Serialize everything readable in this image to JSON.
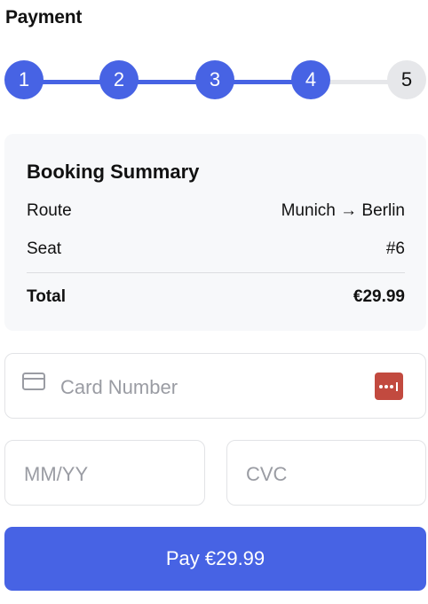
{
  "page": {
    "title": "Payment"
  },
  "stepper": {
    "current_step": 4,
    "steps": [
      {
        "label": "1",
        "state": "complete"
      },
      {
        "label": "2",
        "state": "complete"
      },
      {
        "label": "3",
        "state": "complete"
      },
      {
        "label": "4",
        "state": "current"
      },
      {
        "label": "5",
        "state": "upcoming"
      }
    ]
  },
  "summary": {
    "title": "Booking Summary",
    "rows": [
      {
        "label": "Route",
        "value": "Munich → Berlin"
      },
      {
        "label": "Seat",
        "value": "#6"
      }
    ],
    "total": {
      "label": "Total",
      "value": "€29.99"
    }
  },
  "form": {
    "card_number": {
      "value": "",
      "placeholder": "Card Number",
      "icon": "credit-card-icon"
    },
    "password_manager_icon": "password-manager-icon",
    "expiry": {
      "value": "",
      "placeholder": "MM/YY"
    },
    "cvc": {
      "value": "",
      "placeholder": "CVC"
    }
  },
  "pay_button": {
    "label": "Pay €29.99"
  },
  "colors": {
    "accent": "#4763e4",
    "step_inactive": "#e6e7ea",
    "card_background": "#f7f8fa",
    "password_manager": "#c24a3f"
  }
}
